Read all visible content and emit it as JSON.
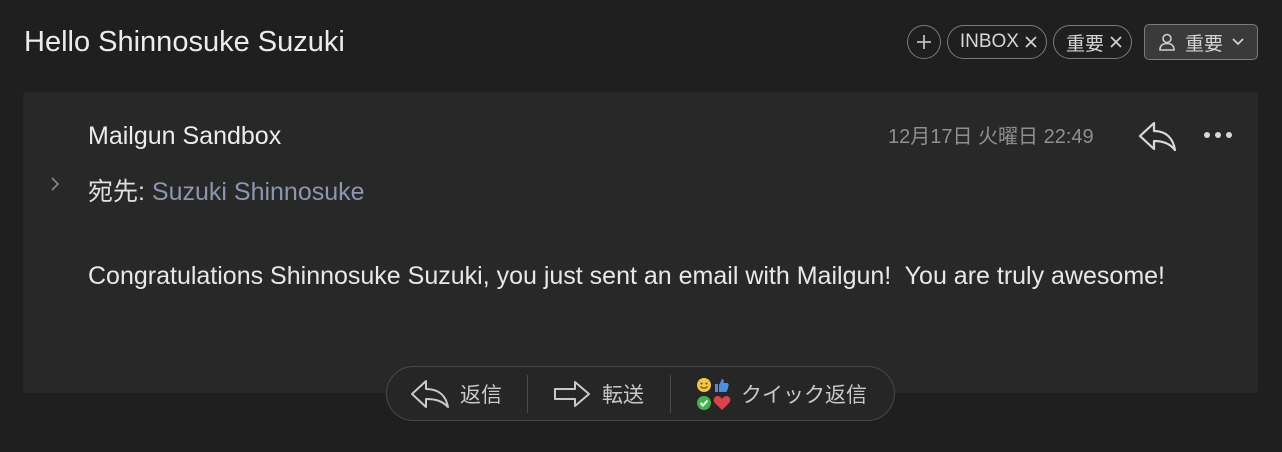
{
  "header": {
    "subject": "Hello Shinnosuke Suzuki",
    "chips": [
      {
        "label": "INBOX"
      },
      {
        "label": "重要"
      }
    ],
    "label_button": "重要"
  },
  "message": {
    "sender": "Mailgun Sandbox",
    "date": "12月17日 火曜日 22:49",
    "to_label": "宛先:",
    "to_name": "Suzuki Shinnosuke",
    "body": "Congratulations Shinnosuke Suzuki, you just sent an email with Mailgun!  You are truly awesome!"
  },
  "actions": {
    "reply": "返信",
    "forward": "転送",
    "quick_reply": "クイック返信"
  },
  "colors": {
    "background": "#1f1f1f",
    "card": "#282828",
    "link": "#8d95b0"
  },
  "icons": [
    "add-label-icon",
    "close-icon",
    "user-icon",
    "chevron-down-icon",
    "reply-icon",
    "more-icon",
    "expand-icon",
    "forward-icon",
    "quick-reply-emoji-icon"
  ]
}
